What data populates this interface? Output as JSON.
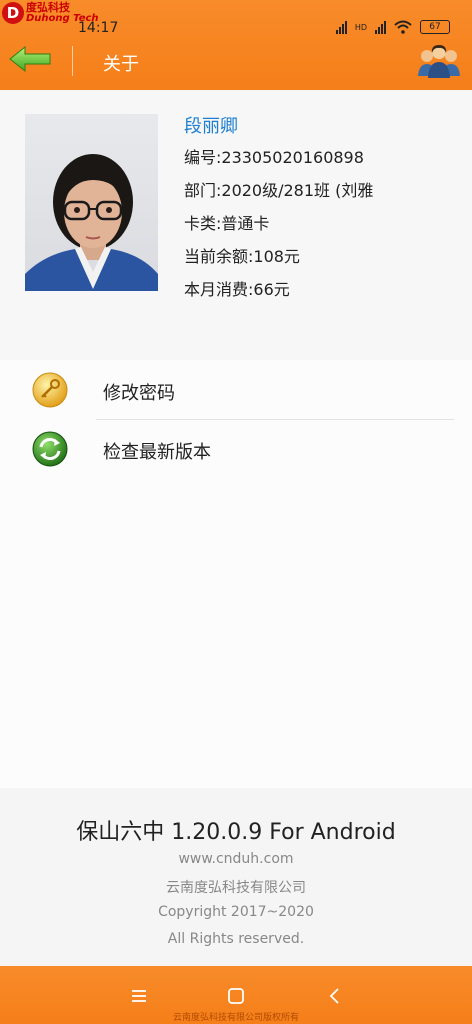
{
  "status_bar": {
    "logo_letter": "D",
    "logo_cn": "度弘科技",
    "logo_en": "Duhong Tech",
    "time": "14:17",
    "hd": "HD",
    "battery": "67"
  },
  "header": {
    "title": "关于"
  },
  "profile": {
    "name": "段丽卿",
    "number": "编号:23305020160898",
    "department": "部门:2020级/281班 (刘雅",
    "card_type": "卡类:普通卡",
    "balance": "当前余额:108元",
    "monthly_spend": "本月消费:66元"
  },
  "menu": {
    "items": [
      {
        "label": "修改密码",
        "icon": "key-icon"
      },
      {
        "label": "检查最新版本",
        "icon": "refresh-icon"
      }
    ]
  },
  "footer": {
    "app_version": "保山六中 1.20.0.9 For Android",
    "website": "www.cnduh.com",
    "company": "云南度弘科技有限公司",
    "copyright": "Copyright 2017~2020",
    "rights": "All Rights reserved."
  },
  "navbar": {
    "watermark": "云南度弘科技有限公司版权所有"
  },
  "colors": {
    "accent": "#f57f19",
    "name_blue": "#1e7fd0"
  }
}
